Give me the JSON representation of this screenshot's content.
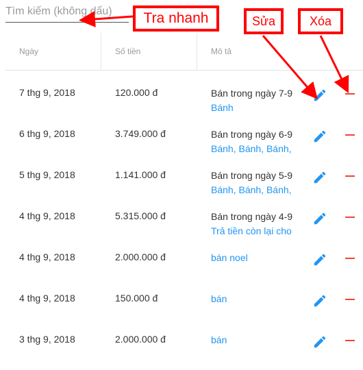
{
  "search": {
    "placeholder": "Tìm kiếm (không dấu)"
  },
  "table": {
    "headers": {
      "date": "Ngày",
      "amount": "Số tiền",
      "description": "Mô tả"
    },
    "rows": [
      {
        "date": "7 thg 9, 2018",
        "amount": "120.000 đ",
        "title": "Bán trong ngày 7-9",
        "tags": "Bánh"
      },
      {
        "date": "6 thg 9, 2018",
        "amount": "3.749.000 đ",
        "title": "Bán trong ngày 6-9",
        "tags": "Bánh, Bánh, Bánh, Bánh"
      },
      {
        "date": "5 thg 9, 2018",
        "amount": "1.141.000 đ",
        "title": "Bán trong ngày 5-9",
        "tags": "Bánh, Bánh, Bánh, Bánh"
      },
      {
        "date": "4 thg 9, 2018",
        "amount": "5.315.000 đ",
        "title": "Bán trong ngày 4-9",
        "tags": "Trả tiền còn lại cho"
      },
      {
        "date": "4 thg 9, 2018",
        "amount": "2.000.000 đ",
        "title": "bán noel",
        "tags": ""
      },
      {
        "date": "4 thg 9, 2018",
        "amount": "150.000 đ",
        "title": "bán",
        "tags": ""
      },
      {
        "date": "3 thg 9, 2018",
        "amount": "2.000.000 đ",
        "title": "bán",
        "tags": ""
      }
    ]
  },
  "annotations": {
    "lookup": "Tra nhanh",
    "edit": "Sửa",
    "delete": "Xóa"
  },
  "icons": {
    "edit": "pencil-icon",
    "delete": "minus-icon"
  },
  "colors": {
    "link": "#2196f3",
    "delete": "#f44336",
    "annotation": "#ff0000"
  }
}
